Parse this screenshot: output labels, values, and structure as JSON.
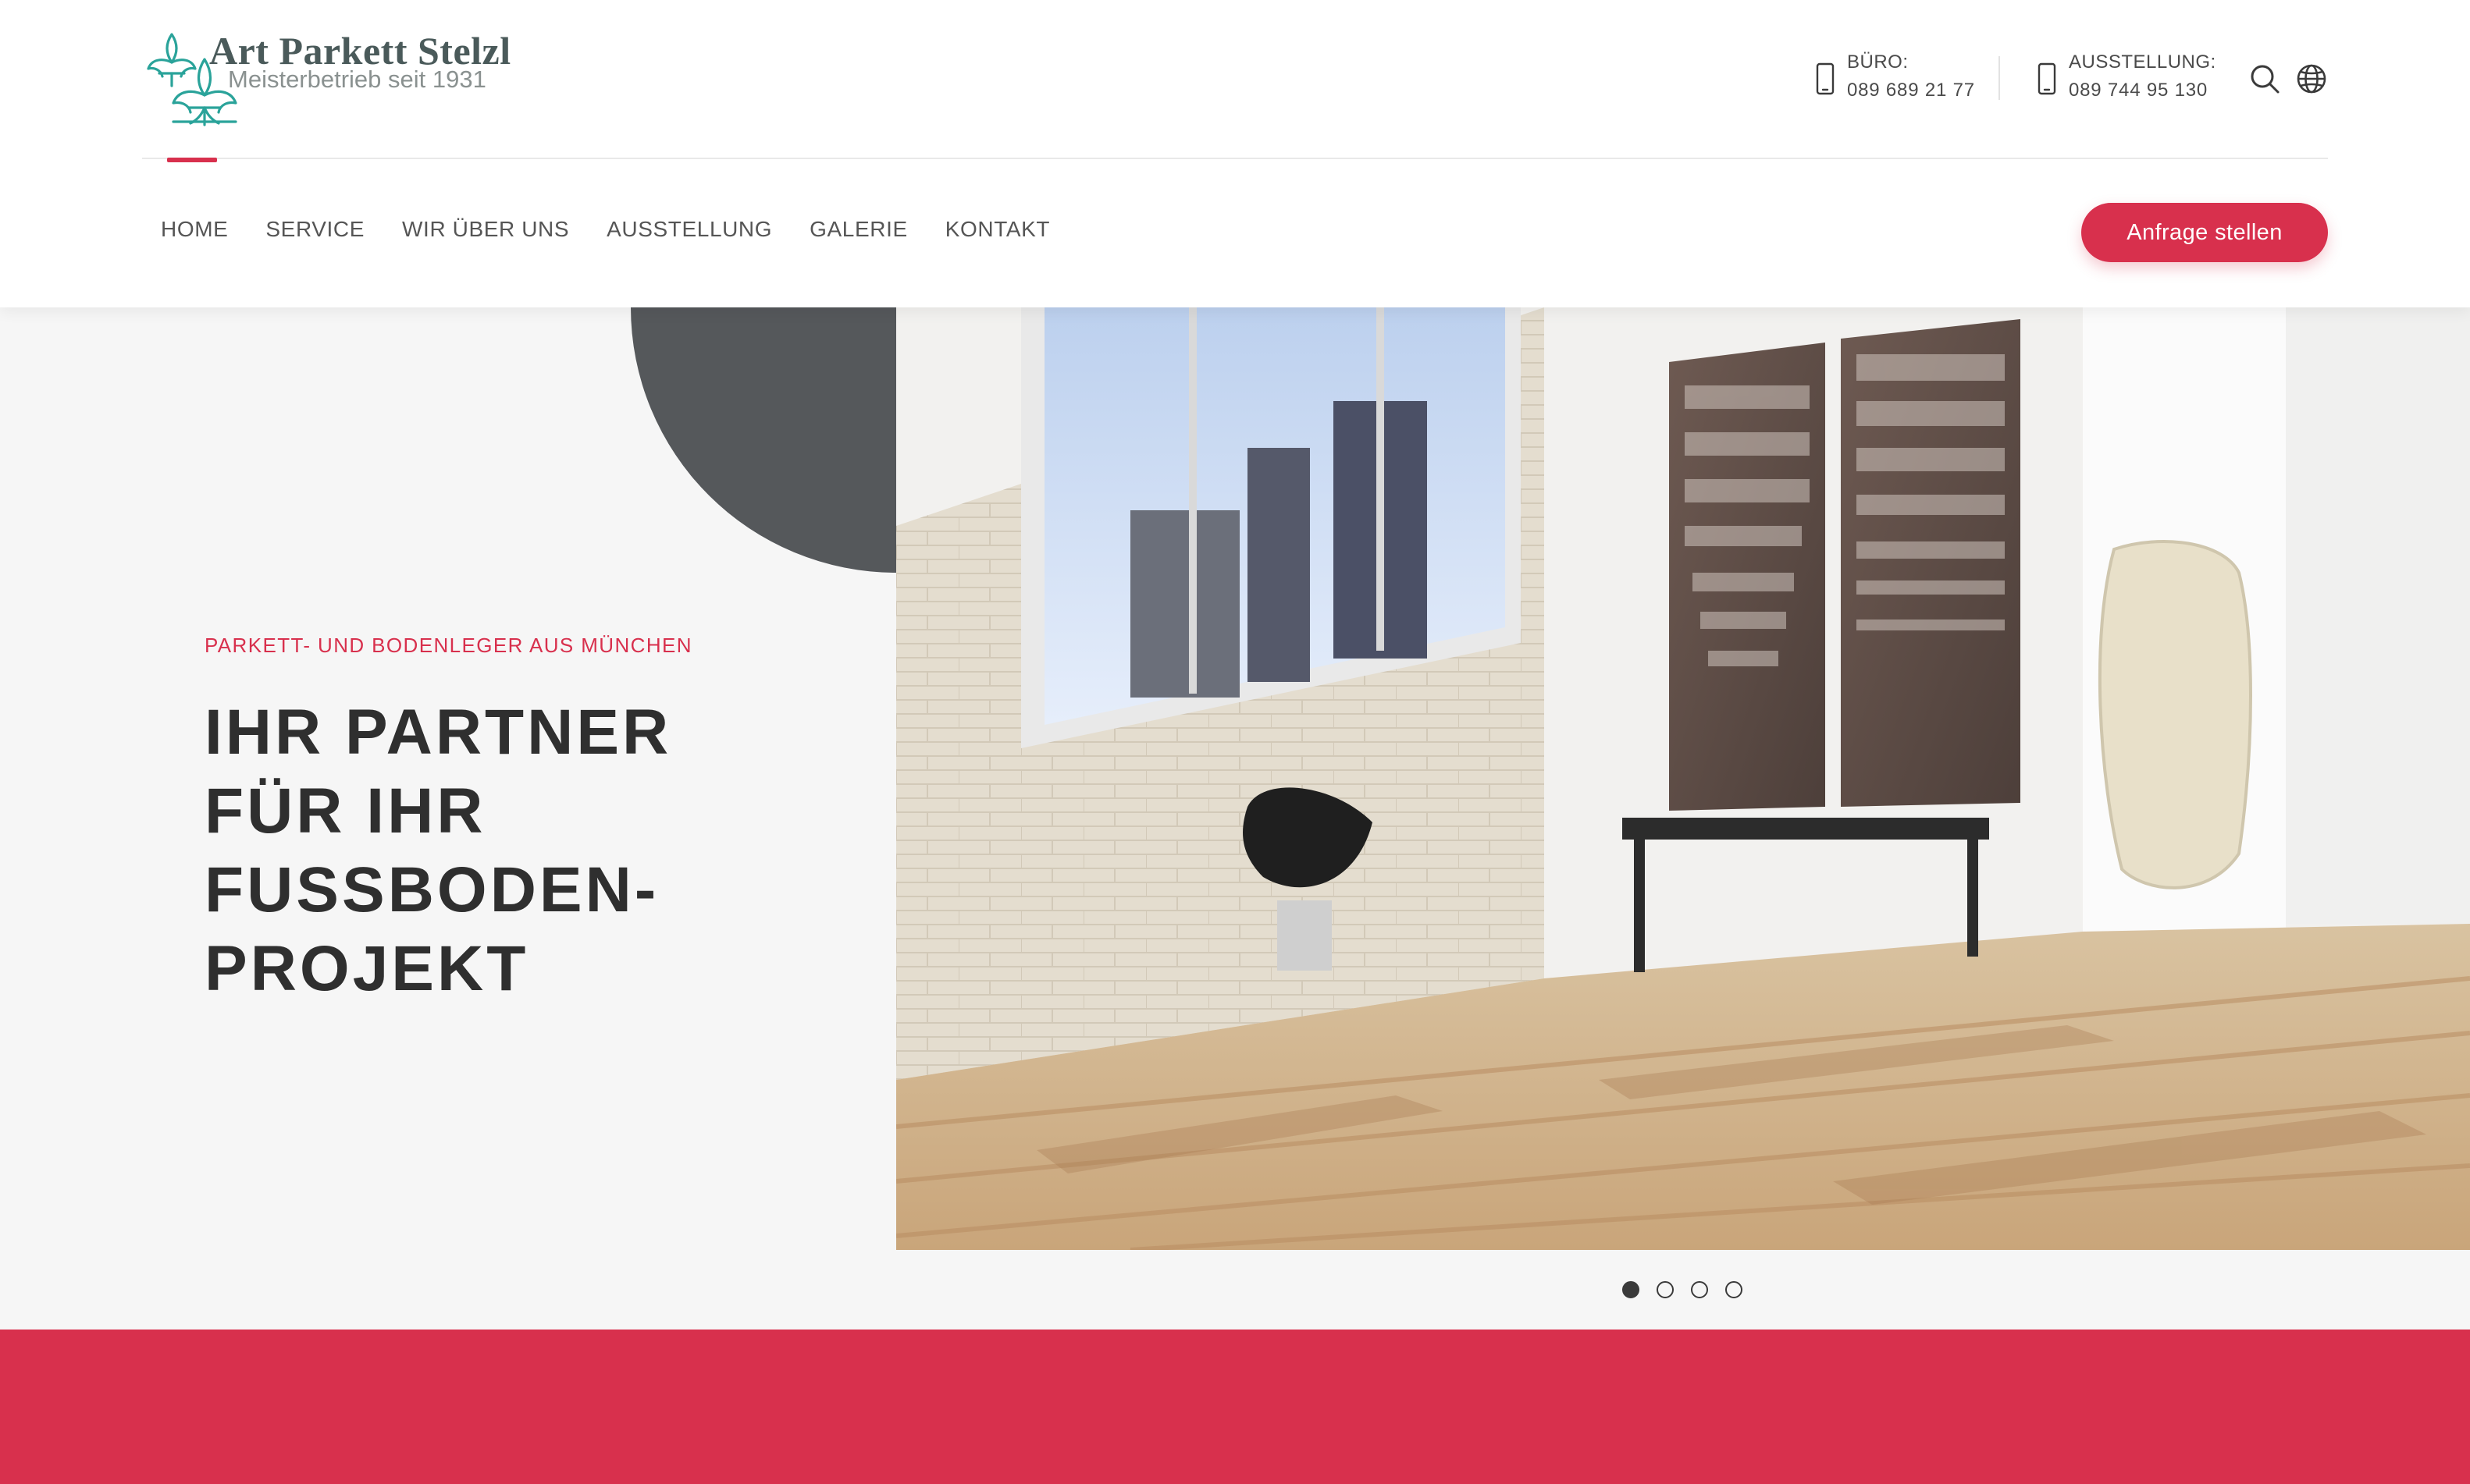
{
  "brand": {
    "name": "Art Parkett Stelzl",
    "subtitle": "Meisterbetrieb seit 1931",
    "logo_icon": "fleur-de-lis-icon",
    "logo_color": "#2aa39a"
  },
  "header": {
    "contacts": [
      {
        "label": "BÜRO:",
        "number": "089 689 21 77",
        "icon": "phone-icon"
      },
      {
        "label": "AUSSTELLUNG:",
        "number": "089 744 95 130",
        "icon": "phone-icon"
      }
    ],
    "search_icon": "search-icon",
    "language_icon": "globe-icon"
  },
  "nav": {
    "items": [
      {
        "label": "HOME",
        "active": true
      },
      {
        "label": "SERVICE",
        "active": false
      },
      {
        "label": "WIR ÜBER UNS",
        "active": false
      },
      {
        "label": "AUSSTELLUNG",
        "active": false
      },
      {
        "label": "GALERIE",
        "active": false
      },
      {
        "label": "KONTAKT",
        "active": false
      }
    ],
    "cta_label": "Anfrage stellen"
  },
  "hero": {
    "tagline": "PARKETT- UND BODENLEGER AUS MÜNCHEN",
    "headline_lines": [
      "IHR PARTNER",
      "FÜR IHR",
      "FUSSBODEN-",
      "PROJEKT"
    ],
    "slides_count": 4,
    "active_slide": 1
  },
  "colors": {
    "accent": "#d8304d",
    "dark_shape": "#55585b",
    "text_dark": "#2f2f2f",
    "hero_bg": "#f6f6f6"
  }
}
